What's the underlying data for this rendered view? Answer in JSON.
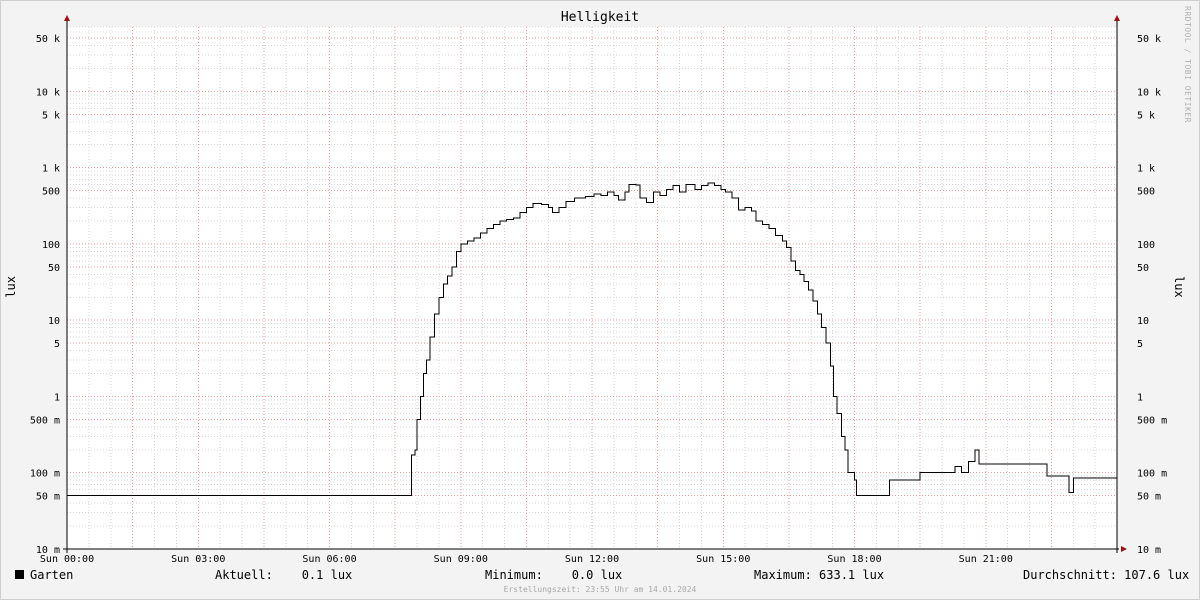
{
  "chart_data": {
    "type": "line",
    "title": "Helligkeit",
    "ylabel": "lux",
    "yscale": "log",
    "ylim": [
      0.01,
      70000
    ],
    "xlim": [
      0,
      24
    ],
    "grid": true,
    "x_ticks": [
      {
        "x": 0,
        "label": "Sun 00:00"
      },
      {
        "x": 3,
        "label": "Sun 03:00"
      },
      {
        "x": 6,
        "label": "Sun 06:00"
      },
      {
        "x": 9,
        "label": "Sun 09:00"
      },
      {
        "x": 12,
        "label": "Sun 12:00"
      },
      {
        "x": 15,
        "label": "Sun 15:00"
      },
      {
        "x": 18,
        "label": "Sun 18:00"
      },
      {
        "x": 21,
        "label": "Sun 21:00"
      }
    ],
    "y_ticks": [
      {
        "y": 0.01,
        "label": "10 m"
      },
      {
        "y": 0.05,
        "label": "50 m"
      },
      {
        "y": 0.1,
        "label": "100 m"
      },
      {
        "y": 0.5,
        "label": "500 m"
      },
      {
        "y": 1,
        "label": "1"
      },
      {
        "y": 5,
        "label": "5"
      },
      {
        "y": 10,
        "label": "10"
      },
      {
        "y": 50,
        "label": "50"
      },
      {
        "y": 100,
        "label": "100"
      },
      {
        "y": 500,
        "label": "500"
      },
      {
        "y": 1000,
        "label": "1 k"
      },
      {
        "y": 5000,
        "label": "5 k"
      },
      {
        "y": 10000,
        "label": "10 k"
      },
      {
        "y": 50000,
        "label": "50 k"
      }
    ],
    "series": [
      {
        "name": "Garten",
        "color": "#000000",
        "points": [
          [
            0.0,
            0.05
          ],
          [
            7.85,
            0.05
          ],
          [
            7.87,
            0.17
          ],
          [
            7.95,
            0.2
          ],
          [
            8.0,
            0.5
          ],
          [
            8.08,
            1.0
          ],
          [
            8.15,
            2.0
          ],
          [
            8.22,
            3.0
          ],
          [
            8.3,
            6.0
          ],
          [
            8.4,
            12.0
          ],
          [
            8.5,
            20.0
          ],
          [
            8.6,
            30.0
          ],
          [
            8.7,
            38.0
          ],
          [
            8.8,
            50.0
          ],
          [
            8.9,
            80.0
          ],
          [
            9.0,
            100.0
          ],
          [
            9.15,
            110.0
          ],
          [
            9.3,
            120.0
          ],
          [
            9.45,
            140.0
          ],
          [
            9.6,
            160.0
          ],
          [
            9.75,
            180.0
          ],
          [
            9.9,
            200.0
          ],
          [
            10.05,
            210.0
          ],
          [
            10.2,
            220.0
          ],
          [
            10.35,
            260.0
          ],
          [
            10.5,
            300.0
          ],
          [
            10.65,
            340.0
          ],
          [
            10.85,
            330.0
          ],
          [
            11.0,
            300.0
          ],
          [
            11.1,
            260.0
          ],
          [
            11.25,
            300.0
          ],
          [
            11.4,
            360.0
          ],
          [
            11.6,
            400.0
          ],
          [
            11.85,
            420.0
          ],
          [
            12.05,
            450.0
          ],
          [
            12.2,
            430.0
          ],
          [
            12.35,
            480.0
          ],
          [
            12.5,
            430.0
          ],
          [
            12.6,
            380.0
          ],
          [
            12.75,
            480.0
          ],
          [
            12.85,
            600.0
          ],
          [
            13.0,
            590.0
          ],
          [
            13.1,
            400.0
          ],
          [
            13.25,
            350.0
          ],
          [
            13.4,
            480.0
          ],
          [
            13.55,
            430.0
          ],
          [
            13.7,
            520.0
          ],
          [
            13.85,
            580.0
          ],
          [
            14.0,
            480.0
          ],
          [
            14.15,
            600.0
          ],
          [
            14.35,
            520.0
          ],
          [
            14.5,
            580.0
          ],
          [
            14.65,
            633.1
          ],
          [
            14.8,
            580.0
          ],
          [
            14.95,
            520.0
          ],
          [
            15.05,
            480.0
          ],
          [
            15.2,
            400.0
          ],
          [
            15.35,
            280.0
          ],
          [
            15.5,
            300.0
          ],
          [
            15.65,
            270.0
          ],
          [
            15.75,
            200.0
          ],
          [
            15.9,
            180.0
          ],
          [
            16.05,
            160.0
          ],
          [
            16.2,
            130.0
          ],
          [
            16.35,
            110.0
          ],
          [
            16.45,
            90.0
          ],
          [
            16.55,
            60.0
          ],
          [
            16.65,
            45.0
          ],
          [
            16.75,
            40.0
          ],
          [
            16.85,
            32.0
          ],
          [
            16.95,
            25.0
          ],
          [
            17.05,
            18.0
          ],
          [
            17.15,
            12.0
          ],
          [
            17.25,
            8.0
          ],
          [
            17.35,
            5.0
          ],
          [
            17.45,
            2.5
          ],
          [
            17.52,
            1.0
          ],
          [
            17.6,
            0.6
          ],
          [
            17.7,
            0.3
          ],
          [
            17.78,
            0.2
          ],
          [
            17.85,
            0.1
          ],
          [
            18.0,
            0.08
          ],
          [
            18.05,
            0.05
          ],
          [
            18.8,
            0.08
          ],
          [
            19.5,
            0.1
          ],
          [
            20.3,
            0.12
          ],
          [
            20.45,
            0.1
          ],
          [
            20.6,
            0.14
          ],
          [
            20.75,
            0.2
          ],
          [
            20.85,
            0.13
          ],
          [
            22.4,
            0.09
          ],
          [
            22.9,
            0.055
          ],
          [
            23.0,
            0.085
          ],
          [
            24.0,
            0.085
          ]
        ]
      }
    ],
    "legend": {
      "placement": "bottom",
      "series_label": "Garten",
      "current": "Aktuell:    0.1 lux",
      "minimum": "Minimum:    0.0 lux",
      "maximum": "Maximum: 633.1 lux",
      "average": "Durchschnitt: 107.6 lux"
    }
  },
  "credit": "RRDTOOL / TOBI OETIKER",
  "footer": "Erstellungszeit: 23:55 Uhr am 14.01.2024",
  "colors": {
    "grid_major": "#e8a0a0",
    "grid_minor": "#d8d8d8",
    "axis_arrow": "#a01010",
    "plot_bg": "#ffffff"
  }
}
